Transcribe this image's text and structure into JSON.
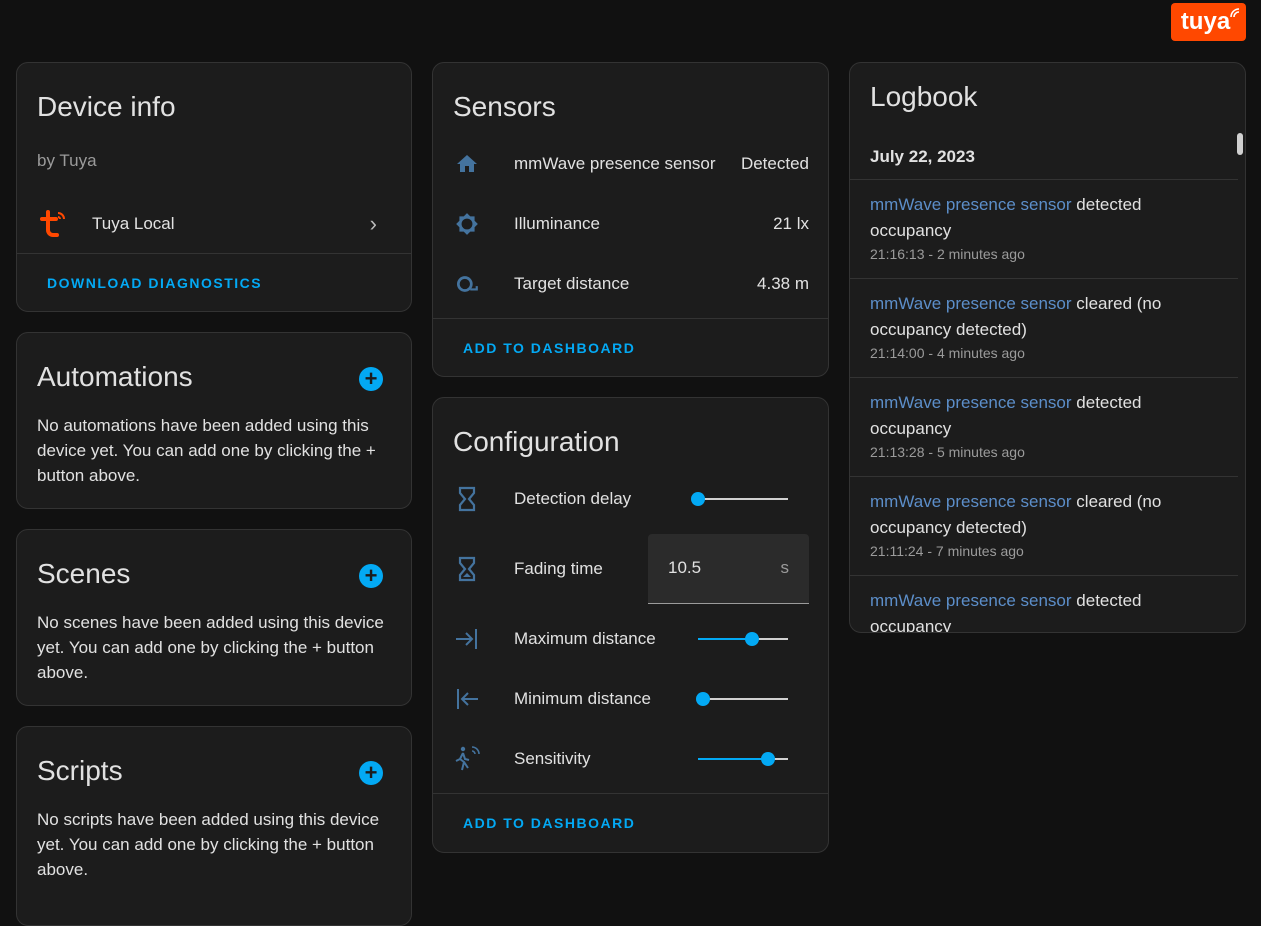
{
  "brand": {
    "logo_text": "tuya",
    "color": "#ff4800"
  },
  "device_info": {
    "title": "Device info",
    "manufacturer": "by Tuya",
    "integration": "Tuya Local",
    "action": "DOWNLOAD DIAGNOSTICS"
  },
  "automations": {
    "title": "Automations",
    "description": "No automations have been added using this device yet. You can add one by clicking the + button above."
  },
  "scenes": {
    "title": "Scenes",
    "description": "No scenes have been added using this device yet. You can add one by clicking the + button above."
  },
  "scripts": {
    "title": "Scripts",
    "description": "No scripts have been added using this device yet. You can add one by clicking the + button above."
  },
  "sensors": {
    "title": "Sensors",
    "items": [
      {
        "icon": "home-icon",
        "label": "mmWave presence sensor",
        "value": "Detected"
      },
      {
        "icon": "brightness-icon",
        "label": "Illuminance",
        "value": "21 lx"
      },
      {
        "icon": "target-distance-icon",
        "label": "Target distance",
        "value": "4.38 m"
      }
    ],
    "action": "ADD TO DASHBOARD"
  },
  "configuration": {
    "title": "Configuration",
    "items": [
      {
        "icon": "hourglass-icon",
        "label": "Detection delay",
        "type": "slider",
        "fraction": 0.0
      },
      {
        "icon": "hourglass-icon",
        "label": "Fading time",
        "type": "number",
        "value": "10.5",
        "unit": "s"
      },
      {
        "icon": "arrow-collapse-right-icon",
        "label": "Maximum distance",
        "type": "slider",
        "fraction": 0.6
      },
      {
        "icon": "arrow-collapse-left-icon",
        "label": "Minimum distance",
        "type": "slider",
        "fraction": 0.05
      },
      {
        "icon": "motion-sensor-icon",
        "label": "Sensitivity",
        "type": "slider",
        "fraction": 0.78
      }
    ],
    "action": "ADD TO DASHBOARD"
  },
  "logbook": {
    "title": "Logbook",
    "date": "July 22, 2023",
    "entries": [
      {
        "entity": "mmWave presence sensor",
        "text": " detected occupancy",
        "time": "21:16:13 - 2 minutes ago"
      },
      {
        "entity": "mmWave presence sensor",
        "text": " cleared (no occupancy detected)",
        "time": "21:14:00 - 4 minutes ago"
      },
      {
        "entity": "mmWave presence sensor",
        "text": " detected occupancy",
        "time": "21:13:28 - 5 minutes ago"
      },
      {
        "entity": "mmWave presence sensor",
        "text": " cleared (no occupancy detected)",
        "time": "21:11:24 - 7 minutes ago"
      },
      {
        "entity": "mmWave presence sensor",
        "text": " detected occupancy",
        "time": ""
      }
    ]
  }
}
